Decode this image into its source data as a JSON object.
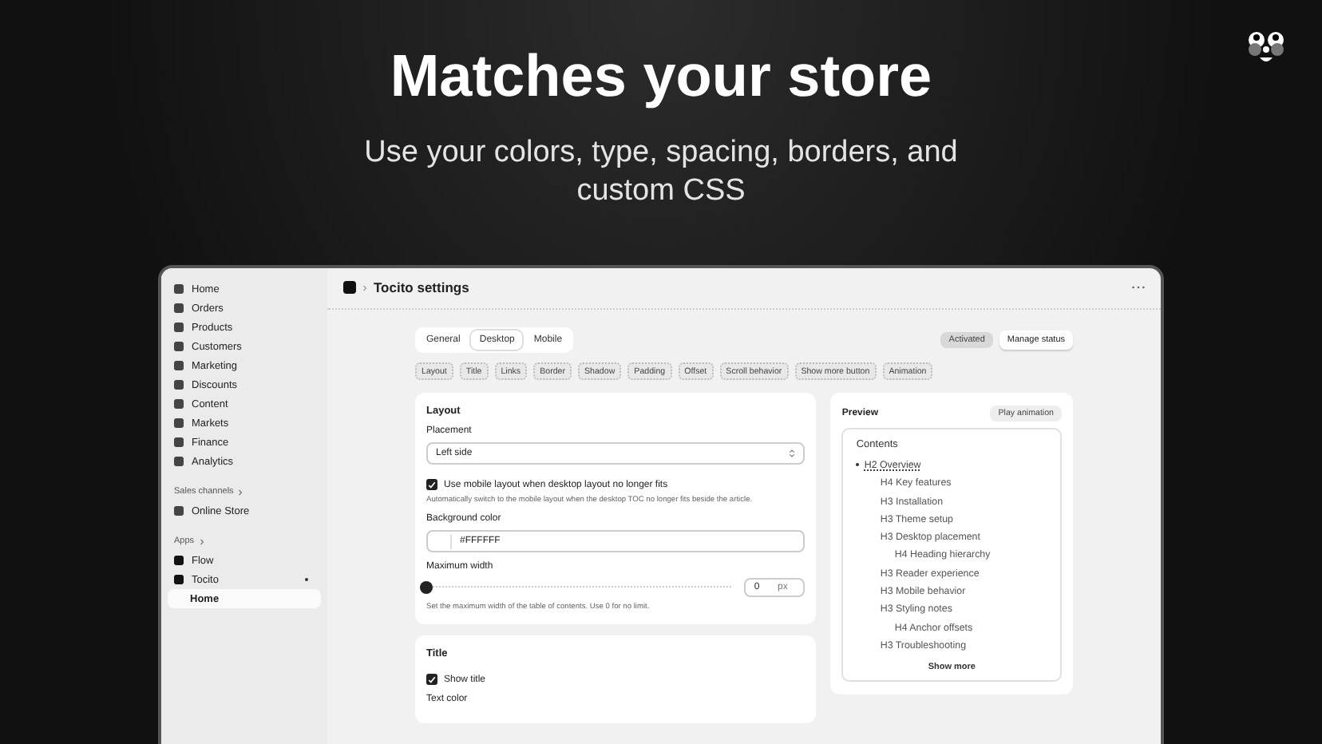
{
  "hero": {
    "title": "Matches your store",
    "subtitle": "Use your colors, type, spacing, borders, and custom CSS"
  },
  "sidebar": {
    "items": [
      {
        "label": "Home",
        "selected": false
      },
      {
        "label": "Orders",
        "selected": false
      },
      {
        "label": "Products",
        "selected": false
      },
      {
        "label": "Customers",
        "selected": false
      },
      {
        "label": "Marketing",
        "selected": false
      },
      {
        "label": "Discounts",
        "selected": false
      },
      {
        "label": "Content",
        "selected": false
      },
      {
        "label": "Markets",
        "selected": false
      },
      {
        "label": "Finance",
        "selected": false
      },
      {
        "label": "Analytics",
        "selected": false
      }
    ],
    "sales_channels": {
      "heading": "Sales channels",
      "items": [
        {
          "label": "Online Store",
          "selected": false
        }
      ]
    },
    "apps": {
      "heading": "Apps",
      "items": [
        {
          "label": "Flow",
          "selected": false,
          "expanded": false
        },
        {
          "label": "Tocito",
          "selected": false,
          "expanded": true,
          "children": [
            {
              "label": "Home",
              "selected": true
            }
          ]
        }
      ]
    }
  },
  "page": {
    "title": "Tocito settings",
    "tabs": [
      {
        "label": "General",
        "selected": false
      },
      {
        "label": "Desktop",
        "selected": true
      },
      {
        "label": "Mobile",
        "selected": false
      }
    ],
    "status_badge": "Activated",
    "status_button": "Manage status",
    "chips": [
      "Layout",
      "Title",
      "Links",
      "Border",
      "Shadow",
      "Padding",
      "Offset",
      "Scroll behavior",
      "Show more button",
      "Animation"
    ],
    "layout_card": {
      "heading": "Layout",
      "placement_label": "Placement",
      "placement_value": "Left side",
      "mobile_checkbox": {
        "label": "Use mobile layout when desktop layout no longer fits",
        "checked": true
      },
      "mobile_help": "Automatically switch to the mobile layout when the desktop TOC no longer fits beside the article.",
      "bg_label": "Background color",
      "bg_value": "#FFFFFF",
      "width_label": "Maximum width",
      "width_slider": {
        "level": 0
      },
      "width_value": "0",
      "width_unit": "px",
      "width_help": "Set the maximum width of the table of contents. Use 0 for no limit."
    },
    "title_card": {
      "heading": "Title",
      "show_title": {
        "label": "Show title",
        "checked": true
      },
      "text_color_label": "Text color"
    },
    "preview": {
      "heading": "Preview",
      "play_button": "Play animation",
      "toc_title": "Contents",
      "items": [
        {
          "label": "H2 Overview",
          "selected": true,
          "children": [
            {
              "label": "H4 Key features",
              "selected": false
            },
            {
              "label": "H3 Installation",
              "selected": false
            },
            {
              "label": "H3 Theme setup",
              "selected": false
            },
            {
              "label": "H3 Desktop placement",
              "selected": false,
              "children": [
                {
                  "label": "H4 Heading hierarchy",
                  "selected": false
                }
              ]
            },
            {
              "label": "H3 Reader experience",
              "selected": false
            },
            {
              "label": "H3 Mobile behavior",
              "selected": false
            },
            {
              "label": "H3 Styling notes",
              "selected": false,
              "children": [
                {
                  "label": "H4 Anchor offsets",
                  "selected": false
                }
              ]
            },
            {
              "label": "H3 Troubleshooting",
              "selected": false
            }
          ]
        }
      ],
      "show_more": "Show more"
    }
  }
}
